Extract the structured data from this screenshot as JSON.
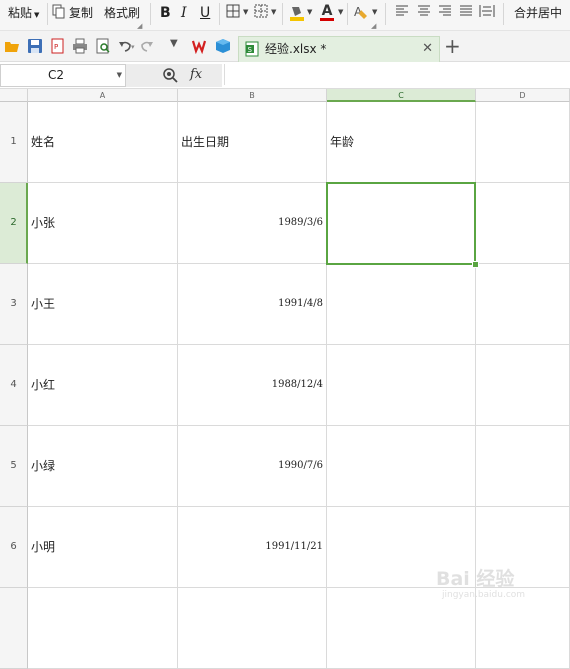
{
  "ribbon": {
    "paste_label": "粘贴",
    "copy_label": "复制",
    "format_painter_label": "格式刷",
    "bold_label": "B",
    "italic_label": "I",
    "underline_label": "U",
    "font_color_label": "A",
    "merge_center_label": "合并居中",
    "fill_color": "#f5c400",
    "font_color": "#d40000"
  },
  "tab": {
    "file_name": "经验.xlsx *",
    "close_symbol": "✕",
    "new_tab_symbol": "+"
  },
  "formula_bar": {
    "name_box": "C2",
    "fx_label": "fx",
    "formula": ""
  },
  "sheet": {
    "columns": [
      "A",
      "B",
      "C",
      "D"
    ],
    "selected_column": "C",
    "rows": [
      {
        "row": "1",
        "a": "姓名",
        "b": "出生日期",
        "c": "年龄"
      },
      {
        "row": "2",
        "a": "小张",
        "b": "1989/3/6",
        "c": ""
      },
      {
        "row": "3",
        "a": "小王",
        "b": "1991/4/8",
        "c": ""
      },
      {
        "row": "4",
        "a": "小红",
        "b": "1988/12/4",
        "c": ""
      },
      {
        "row": "5",
        "a": "小绿",
        "b": "1990/7/6",
        "c": ""
      },
      {
        "row": "6",
        "a": "小明",
        "b": "1991/11/21",
        "c": ""
      }
    ],
    "selected_cell": "C2",
    "accent_color": "#5aa542"
  },
  "watermark": {
    "main": "Bai 经验",
    "sub": "jingyan.baidu.com"
  }
}
